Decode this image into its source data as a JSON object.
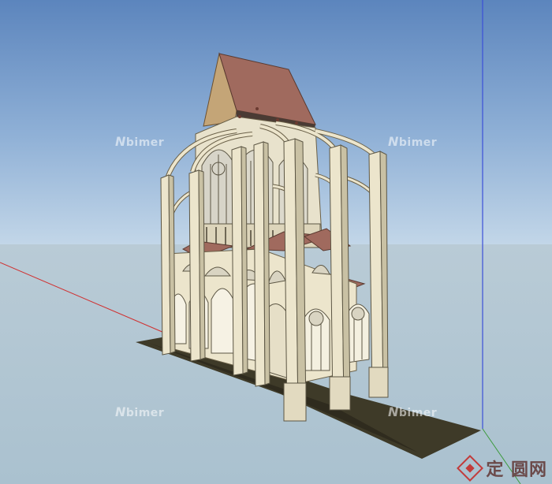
{
  "viewport": {
    "sky_color": "#7a9cc9",
    "ground_color": "#b2c6d2",
    "axis_red": "#d03030",
    "axis_blue": "#3b4fd8",
    "axis_green": "#3c9a3c"
  },
  "model": {
    "roof_color": "#a06a5e",
    "stone_color": "#ece5cc",
    "floor_color": "#3e3a28"
  },
  "watermarks": [
    "bimer",
    "bimer",
    "bimer",
    "bimer"
  ],
  "watermark_brand": "定",
  "brand": {
    "label": "定 圆网",
    "icon": "diamond-logo-icon"
  }
}
